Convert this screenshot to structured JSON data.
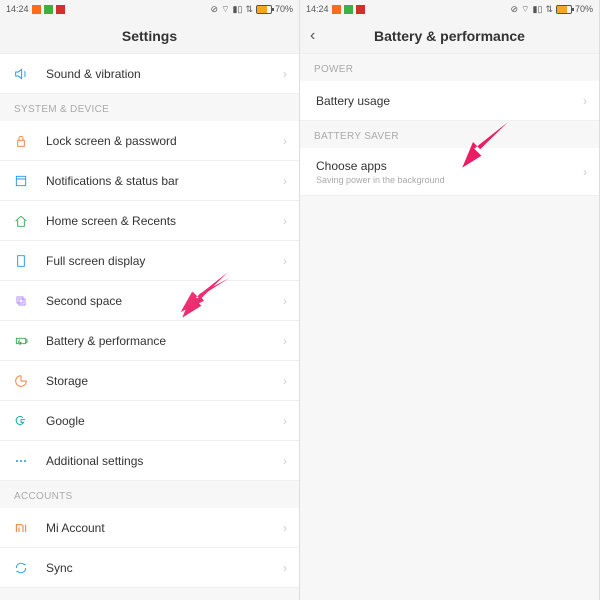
{
  "status": {
    "time": "14:24",
    "battery": "70%"
  },
  "left": {
    "title": "Settings",
    "row_sound": "Sound & vibration",
    "section_system": "SYSTEM & DEVICE",
    "row_lock": "Lock screen & password",
    "row_notif": "Notifications & status bar",
    "row_home": "Home screen & Recents",
    "row_full": "Full screen display",
    "row_second": "Second space",
    "row_batt": "Battery & performance",
    "row_storage": "Storage",
    "row_google": "Google",
    "row_addl": "Additional settings",
    "section_accounts": "ACCOUNTS",
    "row_mi": "Mi Account",
    "row_sync": "Sync"
  },
  "right": {
    "title": "Battery & performance",
    "section_power": "POWER",
    "row_usage": "Battery usage",
    "section_saver": "BATTERY SAVER",
    "row_choose": "Choose apps",
    "row_choose_sub": "Saving power in the background"
  },
  "colors": {
    "blue": "#2196f3",
    "orange": "#ff7a3d",
    "green": "#34a853",
    "teal": "#00a3a3",
    "mi": "#ff6b1c",
    "arrow": "#e91e63"
  }
}
